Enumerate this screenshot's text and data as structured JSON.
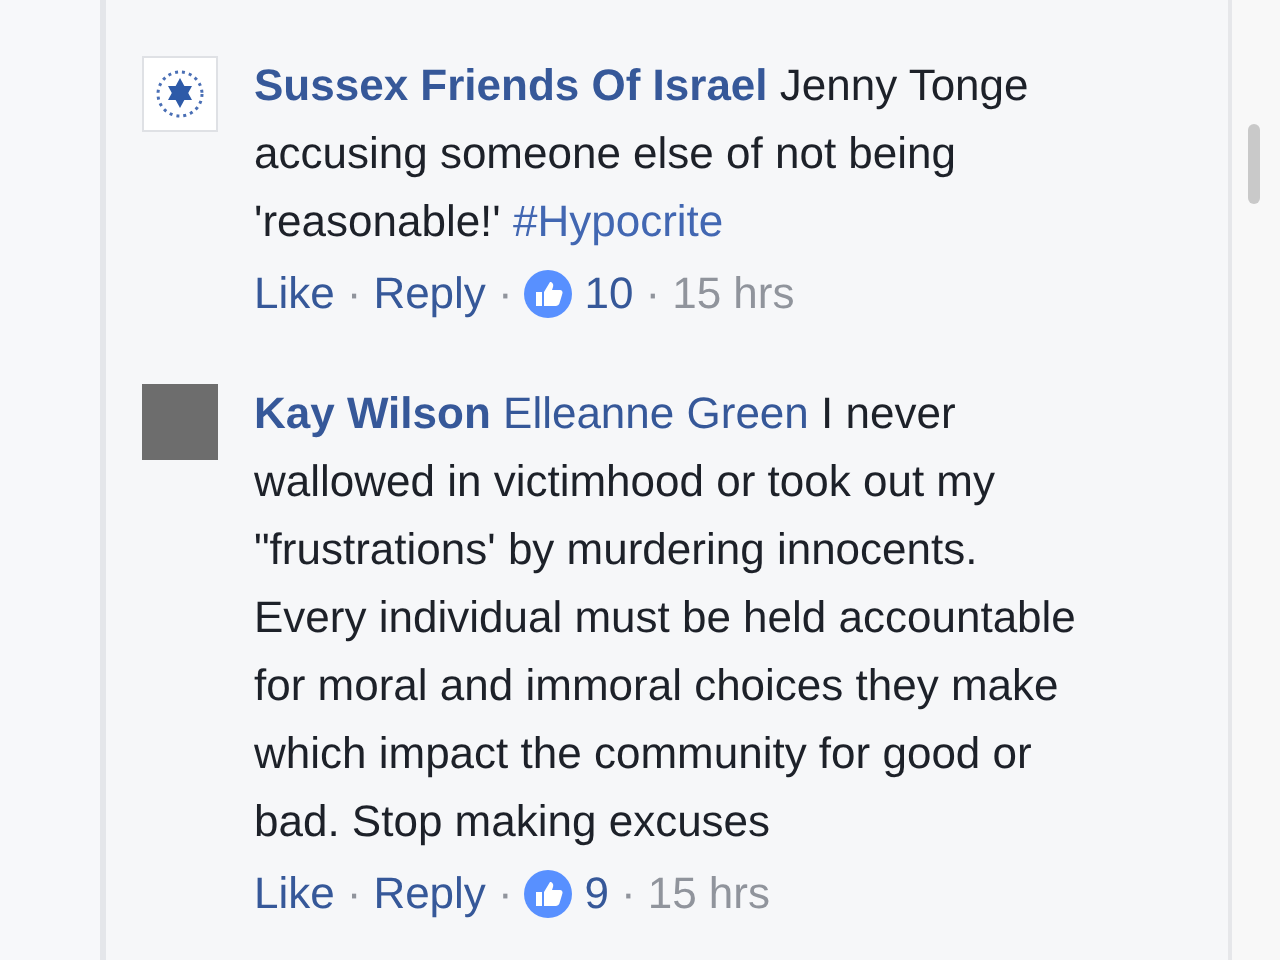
{
  "comments": [
    {
      "kind": "logo",
      "author": "Sussex Friends Of Israel",
      "text": "Jenny Tonge accusing someone else of not being 'reasonable!'",
      "hashtag": "#Hypocrite",
      "like": "Like",
      "separator": "·",
      "reply": "Reply",
      "likes": "10",
      "time": "15 hrs"
    },
    {
      "kind": "photo",
      "author": "Kay Wilson",
      "mention": "Elleanne Green",
      "text": "I never wallowed in victimhood or took out my \"frustrations' by murdering innocents. Every individual must be held accountable for moral and immoral choices they make which impact the community for good or bad. Stop making excuses",
      "like": "Like",
      "separator": "·",
      "reply": "Reply",
      "likes": "9",
      "time": "15 hrs"
    }
  ]
}
